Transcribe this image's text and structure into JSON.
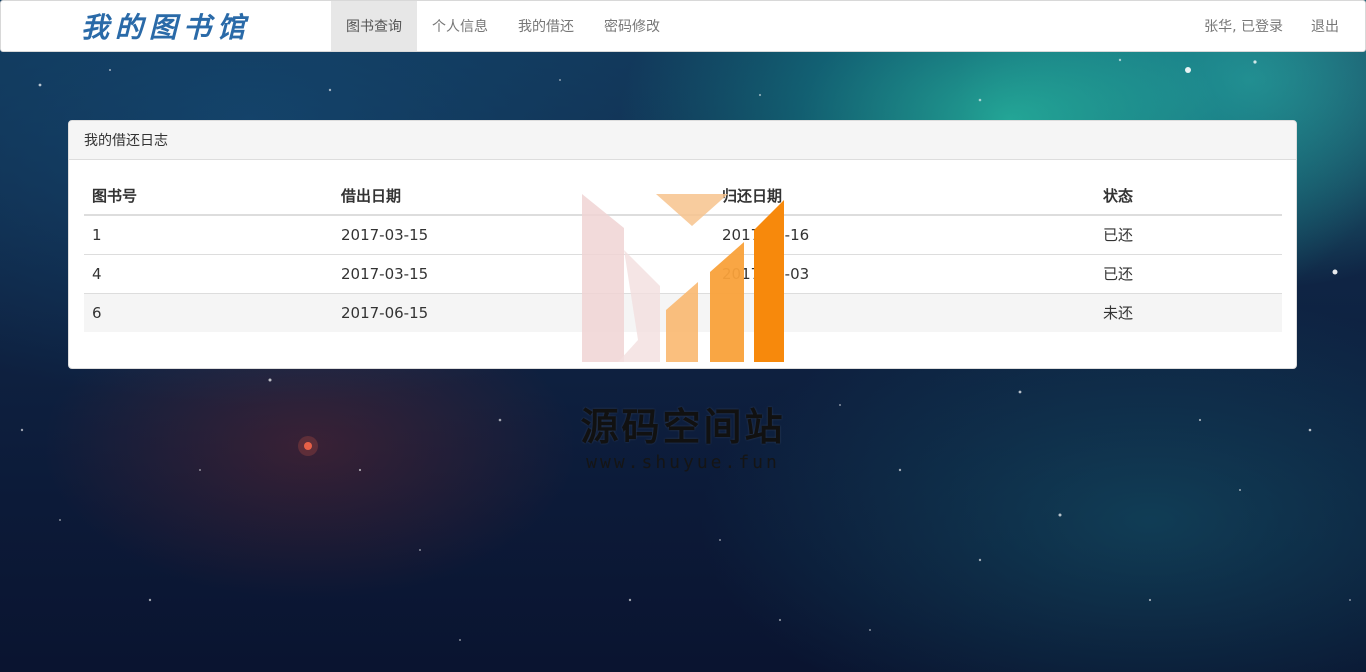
{
  "navbar": {
    "brand": "我的图书馆",
    "items": [
      {
        "label": "图书查询",
        "active": true
      },
      {
        "label": "个人信息",
        "active": false
      },
      {
        "label": "我的借还",
        "active": false
      },
      {
        "label": "密码修改",
        "active": false
      }
    ],
    "user_status": "张华, 已登录",
    "logout": "退出"
  },
  "panel": {
    "title": "我的借还日志",
    "columns": [
      "图书号",
      "借出日期",
      "归还日期",
      "状态"
    ],
    "rows": [
      {
        "book_id": "1",
        "borrow_date": "2017-03-15",
        "return_date": "2017-03-16",
        "status": "已还"
      },
      {
        "book_id": "4",
        "borrow_date": "2017-03-15",
        "return_date": "2017-03-03",
        "status": "已还"
      },
      {
        "book_id": "6",
        "borrow_date": "2017-06-15",
        "return_date": "",
        "status": "未还"
      }
    ]
  },
  "watermark": {
    "title": "源码空间站",
    "url": "www.shuyue.fun"
  },
  "colors": {
    "brand": "#2a6aa8",
    "navbar_active_bg": "#e7e7e7",
    "watermark_orange": "#f7890c",
    "watermark_pink": "#f0d4d4"
  }
}
